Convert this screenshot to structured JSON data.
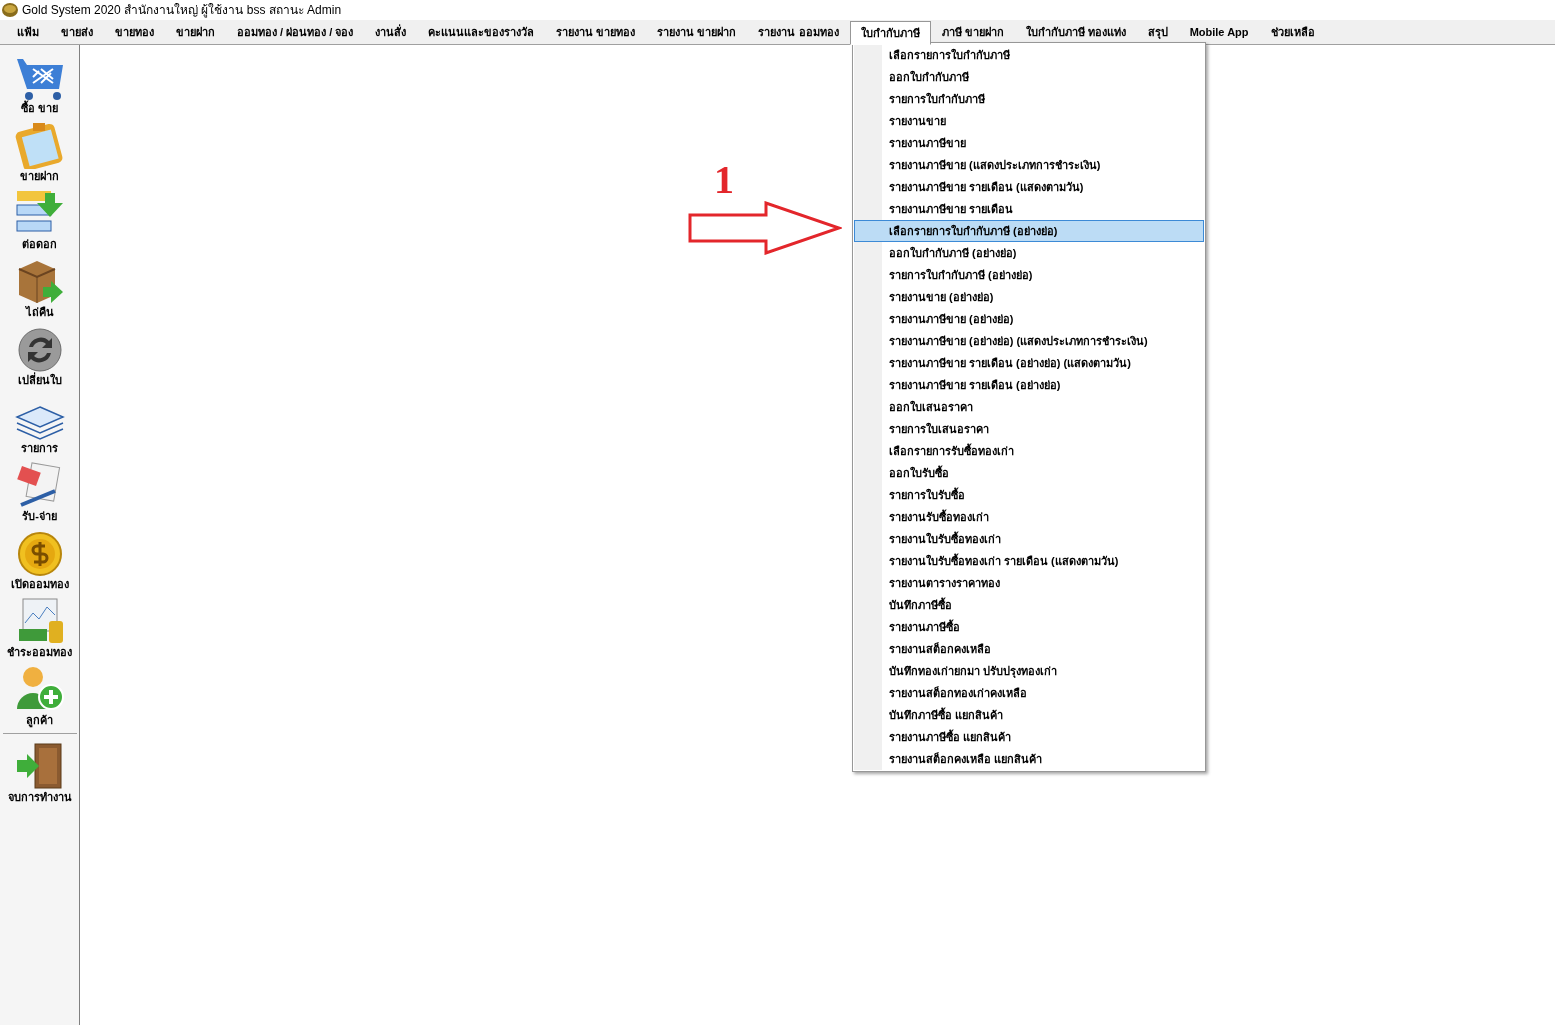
{
  "window": {
    "title": "Gold System 2020  สำนักงานใหญ่ ผู้ใช้งาน bss สถานะ Admin"
  },
  "menu_bar": [
    {
      "label": "แฟ้ม",
      "selected": false
    },
    {
      "label": "ขายส่ง",
      "selected": false
    },
    {
      "label": "ขายทอง",
      "selected": false
    },
    {
      "label": "ขายฝาก",
      "selected": false
    },
    {
      "label": "ออมทอง / ผ่อนทอง / จอง",
      "selected": false
    },
    {
      "label": "งานสั่ง",
      "selected": false
    },
    {
      "label": "คะแนนและของรางวัล",
      "selected": false
    },
    {
      "label": "รายงาน ขายทอง",
      "selected": false
    },
    {
      "label": "รายงาน ขายฝาก",
      "selected": false
    },
    {
      "label": "รายงาน ออมทอง",
      "selected": false
    },
    {
      "label": "ใบกำกับภาษี",
      "selected": true
    },
    {
      "label": "ภาษี ขายฝาก",
      "selected": false
    },
    {
      "label": "ใบกำกับภาษี ทองแท่ง",
      "selected": false
    },
    {
      "label": "สรุป",
      "selected": false
    },
    {
      "label": "Mobile App",
      "selected": false
    },
    {
      "label": "ช่วยเหลือ",
      "selected": false
    }
  ],
  "sidebar": {
    "items": [
      {
        "label": "ซื้อ ขาย",
        "kind": "cart"
      },
      {
        "label": "ขายฝาก",
        "kind": "clipboard"
      },
      {
        "label": "ต่อดอก",
        "kind": "list"
      },
      {
        "label": "ไถ่คืน",
        "kind": "box"
      },
      {
        "label": "เปลี่ยนใบ",
        "kind": "exchange"
      },
      {
        "label": "รายการ",
        "kind": "layers"
      },
      {
        "label": "รับ-จ่าย",
        "kind": "receipt"
      },
      {
        "label": "เปิดออมทอง",
        "kind": "coin"
      },
      {
        "label": "ชำระออมทอง",
        "kind": "chart"
      },
      {
        "label": "ลูกค้า",
        "kind": "customer"
      },
      {
        "label": "จบการทำงาน",
        "kind": "exit"
      }
    ]
  },
  "dropdown_menu": {
    "items": [
      {
        "label": "เลือกรายการใบกำกับภาษี",
        "selected": false
      },
      {
        "label": "ออกใบกำกับภาษี",
        "selected": false
      },
      {
        "label": "รายการใบกำกับภาษี",
        "selected": false
      },
      {
        "label": "รายงานขาย",
        "selected": false
      },
      {
        "label": "รายงานภาษีขาย",
        "selected": false
      },
      {
        "label": "รายงานภาษีขาย (แสดงประเภทการชำระเงิน)",
        "selected": false
      },
      {
        "label": "รายงานภาษีขาย รายเดือน (แสดงตามวัน)",
        "selected": false
      },
      {
        "label": "รายงานภาษีขาย รายเดือน",
        "selected": false
      },
      {
        "label": "เลือกรายการใบกำกับภาษี (อย่างย่อ)",
        "selected": true
      },
      {
        "label": "ออกใบกำกับภาษี (อย่างย่อ)",
        "selected": false
      },
      {
        "label": "รายการใบกำกับภาษี (อย่างย่อ)",
        "selected": false
      },
      {
        "label": "รายงานขาย (อย่างย่อ)",
        "selected": false
      },
      {
        "label": "รายงานภาษีขาย (อย่างย่อ)",
        "selected": false
      },
      {
        "label": "รายงานภาษีขาย (อย่างย่อ)  (แสดงประเภทการชำระเงิน)",
        "selected": false
      },
      {
        "label": "รายงานภาษีขาย รายเดือน (อย่างย่อ) (แสดงตามวัน)",
        "selected": false
      },
      {
        "label": "รายงานภาษีขาย รายเดือน (อย่างย่อ)",
        "selected": false
      },
      {
        "label": "ออกใบเสนอราคา",
        "selected": false
      },
      {
        "label": "รายการใบเสนอราคา",
        "selected": false
      },
      {
        "label": "เลือกรายการรับซื้อทองเก่า",
        "selected": false
      },
      {
        "label": "ออกใบรับซื้อ",
        "selected": false
      },
      {
        "label": "รายการใบรับซื้อ",
        "selected": false
      },
      {
        "label": "รายงานรับซื้อทองเก่า",
        "selected": false
      },
      {
        "label": "รายงานใบรับซื้อทองเก่า",
        "selected": false
      },
      {
        "label": "รายงานใบรับซื้อทองเก่า รายเดือน (แสดงตามวัน)",
        "selected": false
      },
      {
        "label": "รายงานตารางราคาทอง",
        "selected": false
      },
      {
        "label": "บันทึกภาษีซื้อ",
        "selected": false
      },
      {
        "label": "รายงานภาษีซื้อ",
        "selected": false
      },
      {
        "label": "รายงานสต็อกคงเหลือ",
        "selected": false
      },
      {
        "label": "บันทึกทองเก่ายกมา ปรับปรุงทองเก่า",
        "selected": false
      },
      {
        "label": "รายงานสต็อกทองเก่าคงเหลือ",
        "selected": false
      },
      {
        "label": "บันทึกภาษีซื้อ แยกสินค้า",
        "selected": false
      },
      {
        "label": "รายงานภาษีซื้อ แยกสินค้า",
        "selected": false
      },
      {
        "label": "รายงานสต็อกคงเหลือ แยกสินค้า",
        "selected": false
      }
    ]
  },
  "annotation": {
    "number": "1"
  }
}
